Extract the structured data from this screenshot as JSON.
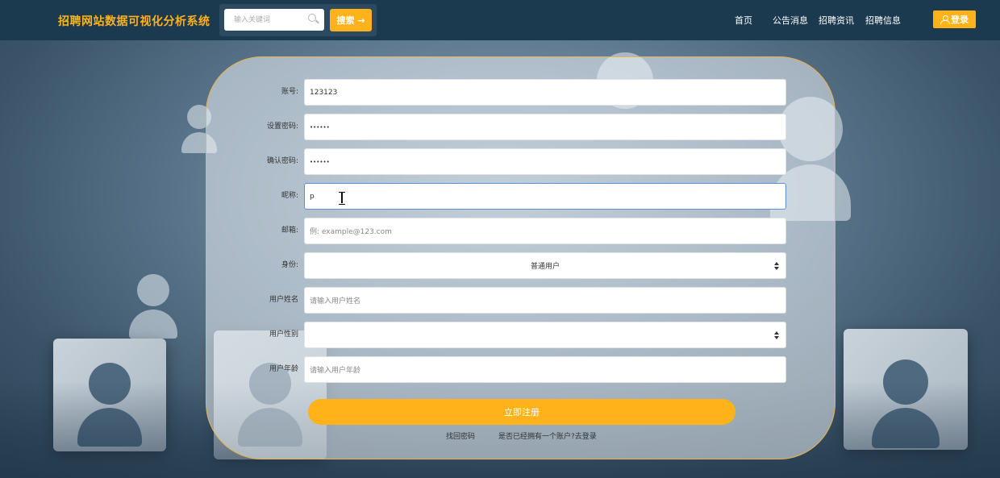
{
  "header": {
    "logo": "招聘网站数据可视化分析系统",
    "search_placeholder": "输入关键词",
    "search_button": "搜索 →",
    "nav": [
      "首页",
      "公告消息",
      "招聘资讯",
      "招聘信息"
    ],
    "login": "登录"
  },
  "form": {
    "fields": [
      {
        "label": "账号:",
        "value": "123123",
        "type": "text"
      },
      {
        "label": "设置密码:",
        "value": "••••••",
        "type": "password"
      },
      {
        "label": "确认密码:",
        "value": "••••••",
        "type": "password"
      },
      {
        "label": "昵称:",
        "value": "p",
        "type": "text"
      },
      {
        "label": "邮箱:",
        "placeholder": "例: example@123.com",
        "type": "text"
      },
      {
        "label": "身份:",
        "value": "普通用户",
        "type": "select"
      },
      {
        "label": "用户姓名",
        "placeholder": "请输入用户姓名",
        "type": "text"
      },
      {
        "label": "用户性别",
        "value": "",
        "type": "select"
      },
      {
        "label": "用户年龄",
        "placeholder": "请输入用户年龄",
        "type": "text"
      }
    ],
    "register_button": "立即注册",
    "forgot_password": "找回密码",
    "have_account": "是否已经拥有一个账户?去登录"
  },
  "colors": {
    "accent": "#ffb219",
    "topbar": "#1c3a4f"
  }
}
